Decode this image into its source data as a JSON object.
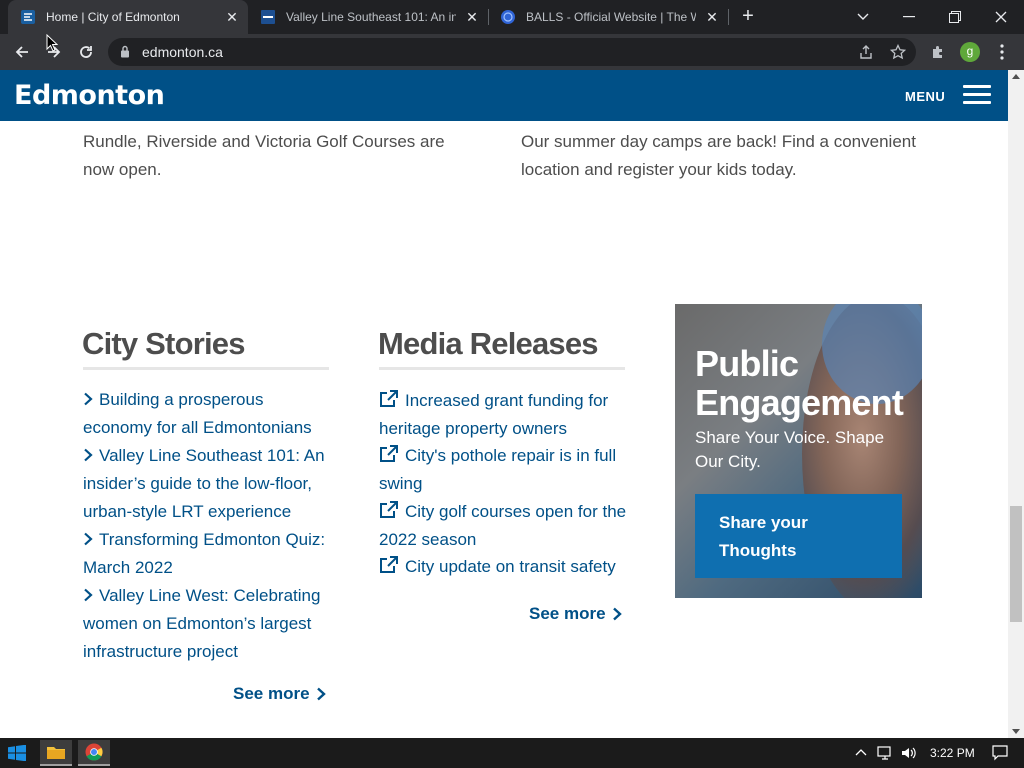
{
  "browser": {
    "tabs": [
      {
        "title": "Home | City of Edmonton",
        "active": true,
        "favicon": "edmonton-favicon"
      },
      {
        "title": "Valley Line Southeast 101: An insid",
        "active": false,
        "favicon": "edmonton-dark-favicon"
      },
      {
        "title": "BALLS - Official Website | The Wo",
        "active": false,
        "favicon": "globe-favicon"
      }
    ],
    "url": "edmonton.ca",
    "profile_initial": "g"
  },
  "site": {
    "logo": "Edmonton",
    "menu_label": "MENU",
    "brand_color": "#005087"
  },
  "teasers": [
    {
      "text": "Rundle, Riverside and Victoria Golf Courses are now open."
    },
    {
      "text": "Our summer day camps are back! Find a convenient location and register your kids today."
    }
  ],
  "city_stories": {
    "heading": "City Stories",
    "items": [
      "Building a prosperous economy for all Edmontonians",
      "Valley Line Southeast 101: An insider’s guide to the low-floor, urban-style LRT experience",
      "Transforming Edmonton Quiz: March 2022",
      "Valley Line West: Celebrating women on Edmonton’s largest infrastructure project"
    ],
    "see_more": "See more"
  },
  "media_releases": {
    "heading": "Media Releases",
    "items": [
      "Increased grant funding for heritage property owners",
      "City's pothole repair is in full swing",
      "City golf courses open for the 2022 season",
      "City update on transit safety"
    ],
    "see_more": "See more"
  },
  "public_engagement": {
    "title": "Public Engagement",
    "subtitle": "Share Your Voice. Shape Our City.",
    "button": "Share your Thoughts"
  },
  "taskbar": {
    "time": "3:22 PM"
  }
}
